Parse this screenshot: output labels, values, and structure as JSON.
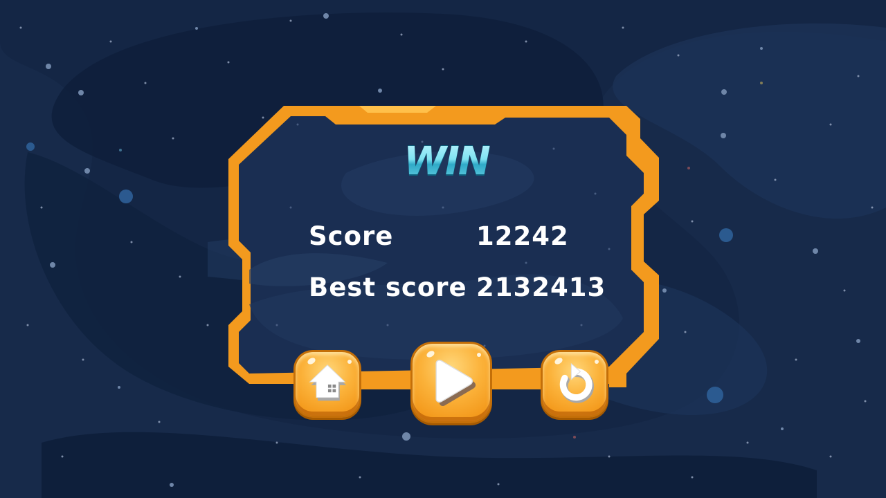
{
  "dialog": {
    "title": "WIN",
    "stats": {
      "score_label": "Score",
      "score_value": "12242",
      "best_label": "Best score",
      "best_value": "2132413"
    }
  },
  "buttons": {
    "home_icon": "home-icon",
    "play_icon": "play-icon",
    "replay_icon": "replay-icon"
  },
  "colors": {
    "background": "#172a4a",
    "frame_accent": "#f39a1e",
    "title_cyan": "#6fd7ea",
    "text": "#ffffff"
  }
}
